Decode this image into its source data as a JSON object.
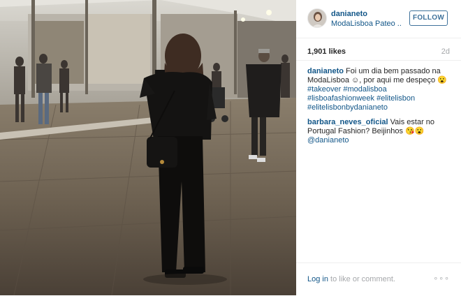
{
  "header": {
    "username": "danianeto",
    "location": "ModaLisboa Pateo ...",
    "follow_label": "FOLLOW"
  },
  "stats": {
    "likes": "1,901 likes",
    "time": "2d"
  },
  "comments": [
    {
      "user": "danianeto",
      "text": "Foi um dia bem passado na ModaLisboa ☺, por aqui me despeço 😮",
      "tags": [
        "#takeover",
        "#modalisboa",
        "#lisboafashionweek",
        "#elitelisbon",
        "#elitelisbonbydanianeto"
      ]
    },
    {
      "user": "barbara_neves_oficial",
      "text": "Vais estar no Portugal Fashion? Beijinhos 😘😮",
      "mention": "@danianeto"
    }
  ],
  "footer": {
    "login_link": "Log in",
    "login_rest": "to like or comment.",
    "more": "∘∘∘"
  },
  "colors": {
    "link": "#125688",
    "follow": "#3f729b",
    "muted": "#a5a7aa"
  }
}
